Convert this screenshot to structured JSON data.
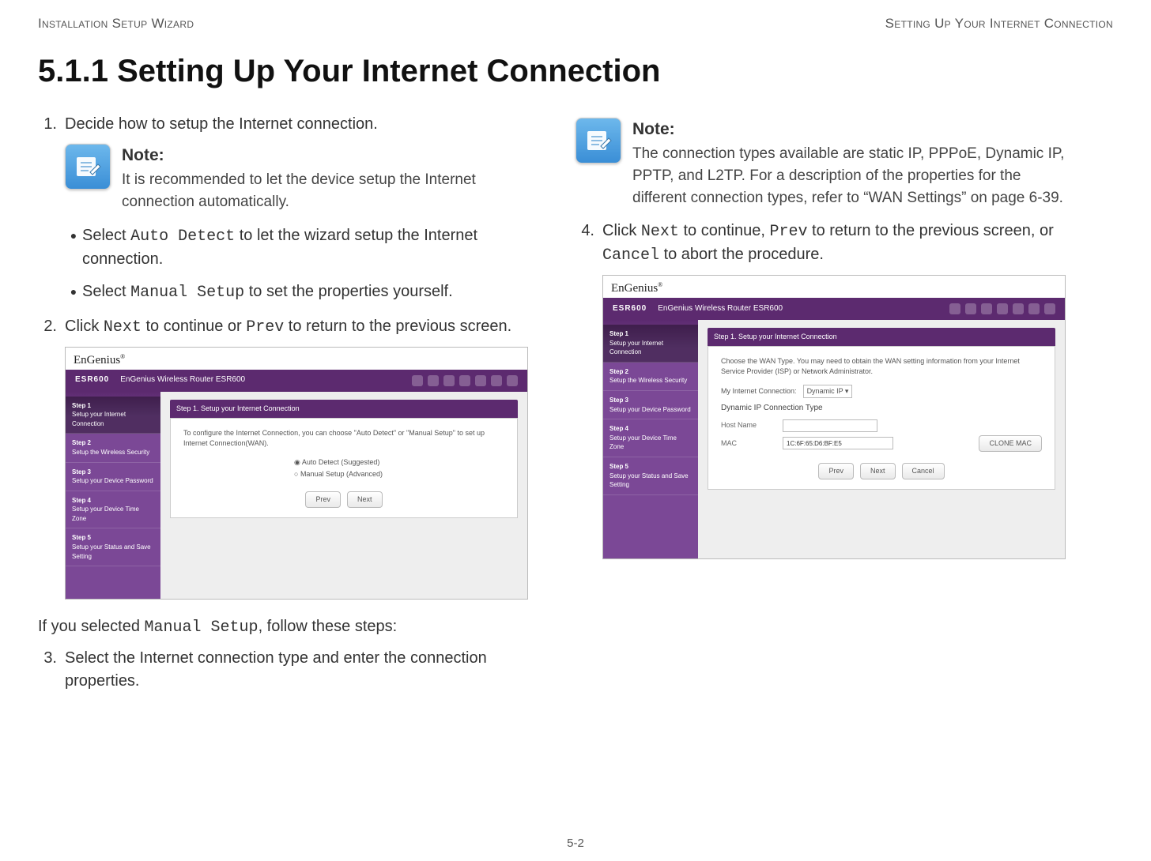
{
  "header": {
    "left": "Installation Setup Wizard",
    "right": "Setting Up Your Internet Connection"
  },
  "title": "5.1.1 Setting Up Your Internet Connection",
  "left": {
    "step1": {
      "num": "1.",
      "text": "Decide how to setup the Internet connection."
    },
    "note": {
      "title": "Note:",
      "text": "It is recommended to let the device setup the Internet connection automatically."
    },
    "bullets": {
      "auto": {
        "pre": "Select ",
        "code": "Auto Detect",
        "post": " to let the wizard setup the Internet connection."
      },
      "manual": {
        "pre": "Select ",
        "code": "Manual Setup",
        "post": " to set the properties yourself."
      }
    },
    "step2": {
      "num": "2.",
      "pre": "Click ",
      "code1": "Next",
      "mid": " to continue or ",
      "code2": "Prev",
      "post": " to return to the previous screen."
    },
    "manualIntro": {
      "pre": "If you selected ",
      "code": "Manual Setup",
      "post": ", follow these steps:"
    },
    "step3": {
      "num": "3.",
      "text": "Select the Internet connection type and enter the connection properties."
    }
  },
  "right": {
    "note": {
      "title": "Note:",
      "text": "The connection types available are static IP, PPPoE, Dynamic IP, PPTP, and L2TP. For a description of the properties for the different connection types, refer to “WAN Settings” on page 6-39."
    },
    "step4": {
      "num": "4.",
      "pre": "Click ",
      "code1": "Next",
      "mid1": " to continue, ",
      "code2": "Prev",
      "mid2": " to return to the previous screen, or ",
      "code3": "Cancel",
      "post": " to abort the procedure."
    }
  },
  "shot": {
    "logo": "EnGenius",
    "model": "ESR600",
    "barTitle": "EnGenius Wireless Router ESR600",
    "steps": {
      "s1": {
        "title": "Step 1",
        "desc": "Setup your Internet Connection"
      },
      "s2": {
        "title": "Step 2",
        "desc": "Setup the Wireless Security"
      },
      "s3": {
        "title": "Step 3",
        "desc": "Setup your Device Password"
      },
      "s4": {
        "title": "Step 4",
        "desc": "Setup your Device Time Zone"
      },
      "s5": {
        "title": "Step 5",
        "desc": "Setup your Status and Save Setting"
      }
    },
    "panelTitle": "Step 1. Setup your Internet Connection",
    "hint1": "To configure the Internet Connection, you can choose \"Auto Detect\" or \"Manual Setup\" to set up Internet Connection(WAN).",
    "radioAuto": "Auto Detect (Suggested)",
    "radioManual": "Manual Setup (Advanced)",
    "btnPrev": "Prev",
    "btnNext": "Next",
    "btnCancel": "Cancel",
    "hint2a": "Choose the WAN Type. You may need to obtain the WAN setting information from your Internet Service Provider (ISP) or Network Administrator.",
    "hint2b": "My Internet Connection:",
    "selVal": "Dynamic IP",
    "subhead": "Dynamic IP Connection Type",
    "host": "Host Name",
    "mac": "MAC",
    "macVal": "1C:6F:65:D6:BF:E5",
    "clone": "CLONE MAC"
  },
  "pageNum": "5-2"
}
